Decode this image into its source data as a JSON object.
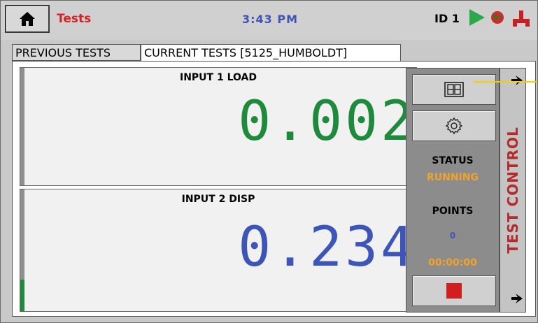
{
  "header": {
    "title": "Tests",
    "clock": "3:43 PM",
    "device_id": "ID 1"
  },
  "tabs": [
    {
      "label": "PREVIOUS TESTS",
      "active": false
    },
    {
      "label": "CURRENT TESTS [5125_HUMBOLDT]",
      "active": true
    }
  ],
  "inputs": [
    {
      "title": "INPUT 1 LOAD",
      "value": "0.002",
      "color": "#1e8a3c"
    },
    {
      "title": "INPUT 2 DISP",
      "value": "0.234",
      "color": "#3c55b6",
      "level": 0.26
    }
  ],
  "control": {
    "status_label": "STATUS",
    "status_value": "RUNNING",
    "points_label": "POINTS",
    "points_value": "0",
    "elapsed": "00:00:00",
    "side_tab_label": "TEST CONTROL",
    "accent_orange": "#f0a22a",
    "stop_color": "#d11f1f"
  },
  "icons": [
    "home-icon",
    "play-icon",
    "globe-icon",
    "network-icon",
    "layout-grid-icon",
    "gear-icon",
    "stop-icon",
    "arrow-icon"
  ]
}
